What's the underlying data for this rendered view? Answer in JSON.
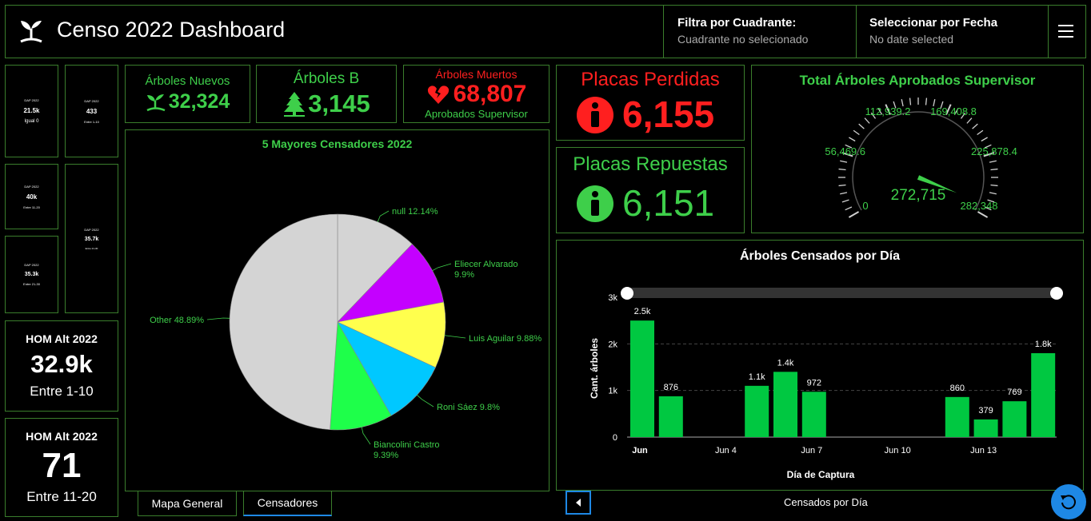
{
  "header": {
    "title": "Censo 2022 Dashboard",
    "filter_quadrant": {
      "label": "Filtra por Cuadrante:",
      "value": "Cuadrante no selecionado"
    },
    "filter_date": {
      "label": "Seleccionar por Fecha",
      "value": "No date selected"
    }
  },
  "mini_cards": [
    {
      "title": "DAP 2022",
      "value": "21.5k",
      "sub": "Igual 0"
    },
    {
      "title": "DAP 2022",
      "value": "433",
      "sub": "Entre 1-10"
    },
    {
      "title": "DAP 2022",
      "value": "40k",
      "sub": "Entre 11-20"
    },
    {
      "title": "DAP 2022",
      "value": "35.7k",
      "sub": "Entre 21-30"
    },
    {
      "title": "DAP 2022",
      "value": "35.3k",
      "sub": "Entre 21-30"
    }
  ],
  "hom_cards": [
    {
      "title": "HOM Alt 2022",
      "value": "32.9k",
      "sub": "Entre 1-10"
    },
    {
      "title": "HOM Alt 2022",
      "value": "71",
      "sub": "Entre 11-20"
    }
  ],
  "kpis": {
    "nuevos": {
      "label": "Árboles Nuevos",
      "value": "32,324"
    },
    "b": {
      "label": "Árboles B",
      "value": "3,145"
    },
    "muertos": {
      "label": "Árboles Muertos",
      "value": "68,807",
      "sub": "Aprobados Supervisor"
    },
    "perdidas": {
      "label": "Placas Perdidas",
      "value": "6,155"
    },
    "repuestas": {
      "label": "Placas Repuestas",
      "value": "6,151"
    }
  },
  "colors": {
    "accent": "#3ecf4a",
    "border": "#3a7d2c",
    "red": "#ff1f1f",
    "bar": "#00c841",
    "tab_active": "#1e88e5"
  },
  "gauge": {
    "title": "Total Árboles Aprobados Supervisor",
    "value_label": "272,715",
    "value": 272715,
    "min": 0,
    "max": 282348,
    "tick_labels": [
      "0",
      "56,469.6",
      "112,939.2",
      "169,408.8",
      "225,878.4",
      "282,348"
    ]
  },
  "pie": {
    "title": "5 Mayores Censadores 2022",
    "chart_data": {
      "type": "pie",
      "slices": [
        {
          "label": "null 12.14%",
          "value": 12.14,
          "color": "#d4d4d4"
        },
        {
          "label": "Eliecer Alvarado 9.9%",
          "value": 9.9,
          "color": "#c400ff"
        },
        {
          "label": "Luis Aguilar 9.88%",
          "value": 9.88,
          "color": "#ffff4d"
        },
        {
          "label": "Roni Sáez 9.8%",
          "value": 9.8,
          "color": "#00c8ff"
        },
        {
          "label": "Biancolini Castro 9.39%",
          "value": 9.39,
          "color": "#1eff4a"
        },
        {
          "label": "Other 48.89%",
          "value": 48.89,
          "color": "#d4d4d4"
        }
      ]
    }
  },
  "bar": {
    "title": "Árboles Censados por Día",
    "chart_data": {
      "type": "bar",
      "xlabel": "Día de Captura",
      "ylabel": "Cant. árboles",
      "ylim": [
        0,
        3000
      ],
      "y_ticks": [
        "0",
        "1k",
        "2k",
        "3k"
      ],
      "x_ticks": [
        "Jun",
        "Jun 4",
        "Jun 7",
        "Jun 10",
        "Jun 13"
      ],
      "bars": [
        {
          "day": 1,
          "value": 2500,
          "label": "2.5k"
        },
        {
          "day": 2,
          "value": 876,
          "label": "876"
        },
        {
          "day": 5,
          "value": 1100,
          "label": "1.1k"
        },
        {
          "day": 6,
          "value": 1400,
          "label": "1.4k"
        },
        {
          "day": 7,
          "value": 972,
          "label": "972"
        },
        {
          "day": 12,
          "value": 860,
          "label": "860"
        },
        {
          "day": 13,
          "value": 379,
          "label": "379"
        },
        {
          "day": 14,
          "value": 769,
          "label": "769"
        },
        {
          "day": 15,
          "value": 1800,
          "label": "1.8k"
        }
      ]
    }
  },
  "tabs": {
    "left": [
      "Mapa General",
      "Censadores"
    ],
    "right_label": "Censados por Día"
  }
}
